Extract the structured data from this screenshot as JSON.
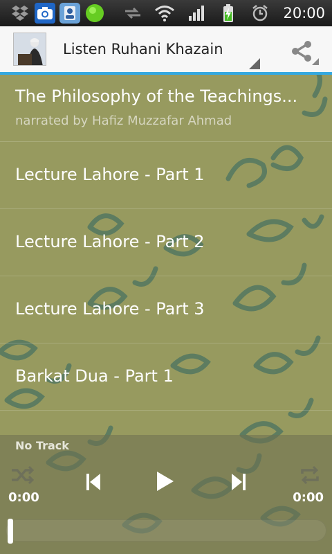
{
  "statusbar": {
    "time": "20:00",
    "icons": [
      "dropbox-icon",
      "camera-icon",
      "contacts-app-icon",
      "green-dot-icon",
      "sync-arrows-icon",
      "wifi-icon",
      "signal-icon",
      "battery-charging-icon",
      "alarm-icon"
    ]
  },
  "actionbar": {
    "title": "Listen Ruhani Khazain",
    "share_icon": "share-icon",
    "accent_color": "#35a9e0"
  },
  "list": {
    "items": [
      {
        "title": "The Philosophy of the Teachings...",
        "subtitle": "narrated by Hafiz Muzzafar Ahmad"
      },
      {
        "title": "Lecture Lahore - Part 1"
      },
      {
        "title": "Lecture Lahore - Part 2"
      },
      {
        "title": "Lecture Lahore - Part 3"
      },
      {
        "title": "Barkat Dua - Part 1"
      }
    ],
    "background_color": "#979a5f"
  },
  "player": {
    "track": "No Track",
    "elapsed": "0:00",
    "duration": "0:00",
    "progress": 0,
    "controls": [
      "shuffle-icon",
      "previous-icon",
      "play-icon",
      "next-icon",
      "repeat-icon"
    ]
  }
}
